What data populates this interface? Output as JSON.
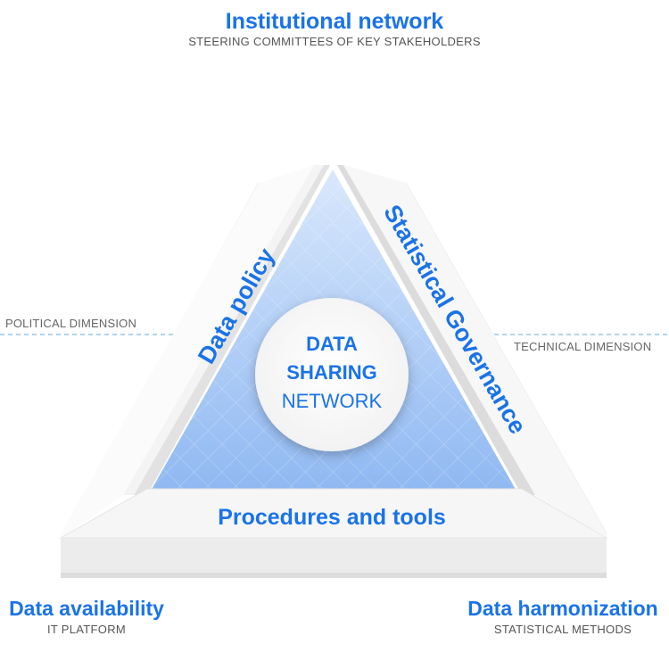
{
  "top": {
    "title": "Institutional network",
    "subtitle": "STEERING COMMITTEES OF KEY STAKEHOLDERS"
  },
  "left_dimension": "POLITICAL DIMENSION",
  "right_dimension": "TECHNICAL DIMENSION",
  "sides": {
    "left": "Data policy",
    "right": "Statistical Governance",
    "bottom": "Procedures and tools"
  },
  "center": {
    "line1": "DATA",
    "line2": "SHARING",
    "line3": "NETWORK"
  },
  "bottom_left": {
    "title": "Data availability",
    "subtitle": "IT PLATFORM"
  },
  "bottom_right": {
    "title": "Data harmonization",
    "subtitle": "STATISTICAL METHODS"
  },
  "colors": {
    "accent": "#1a73e8",
    "inner_fill": "#a9c8f5",
    "frame": "#f3f3f3",
    "dashed": "#5aa9e6"
  }
}
